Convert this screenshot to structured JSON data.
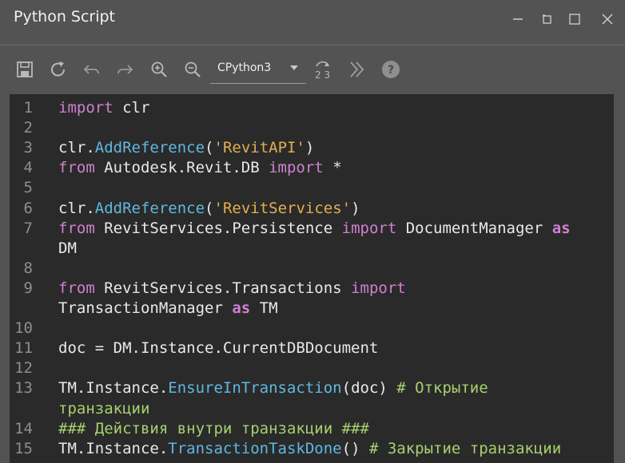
{
  "window": {
    "title": "Python Script"
  },
  "toolbar": {
    "icons": [
      "save-icon",
      "refresh-icon",
      "undo-icon",
      "redo-icon",
      "zoom-in-icon",
      "zoom-out-icon",
      "run-icon",
      "more-icon",
      "help-icon"
    ],
    "engine_value": "CPython3",
    "run_label": "2 3",
    "help_label": "?"
  },
  "editor": {
    "lines": [
      {
        "num": "1",
        "tokens": [
          {
            "t": "import",
            "c": "kw"
          },
          {
            "t": " clr",
            "c": "ident"
          }
        ]
      },
      {
        "num": "2",
        "tokens": []
      },
      {
        "num": "3",
        "tokens": [
          {
            "t": "clr.",
            "c": "ident"
          },
          {
            "t": "AddReference",
            "c": "fn"
          },
          {
            "t": "(",
            "c": "ident"
          },
          {
            "t": "'RevitAPI'",
            "c": "str"
          },
          {
            "t": ")",
            "c": "ident"
          }
        ]
      },
      {
        "num": "4",
        "tokens": [
          {
            "t": "from",
            "c": "kw"
          },
          {
            "t": " Autodesk.Revit.DB ",
            "c": "ident"
          },
          {
            "t": "import",
            "c": "kw"
          },
          {
            "t": " *",
            "c": "ident"
          }
        ]
      },
      {
        "num": "5",
        "tokens": []
      },
      {
        "num": "6",
        "tokens": [
          {
            "t": "clr.",
            "c": "ident"
          },
          {
            "t": "AddReference",
            "c": "fn"
          },
          {
            "t": "(",
            "c": "ident"
          },
          {
            "t": "'RevitServices'",
            "c": "str"
          },
          {
            "t": ")",
            "c": "ident"
          }
        ]
      },
      {
        "num": "7",
        "tokens": [
          {
            "t": "from",
            "c": "kw"
          },
          {
            "t": " RevitServices.Persistence ",
            "c": "ident"
          },
          {
            "t": "import",
            "c": "kw"
          },
          {
            "t": " DocumentManager ",
            "c": "ident"
          },
          {
            "t": "as",
            "c": "as"
          }
        ]
      },
      {
        "num": "",
        "tokens": [
          {
            "t": "DM",
            "c": "ident"
          }
        ]
      },
      {
        "num": "8",
        "tokens": []
      },
      {
        "num": "9",
        "tokens": [
          {
            "t": "from",
            "c": "kw"
          },
          {
            "t": " RevitServices.Transactions ",
            "c": "ident"
          },
          {
            "t": "import",
            "c": "kw"
          }
        ]
      },
      {
        "num": "",
        "tokens": [
          {
            "t": "TransactionManager ",
            "c": "ident"
          },
          {
            "t": "as",
            "c": "as"
          },
          {
            "t": " TM",
            "c": "ident"
          }
        ]
      },
      {
        "num": "10",
        "tokens": []
      },
      {
        "num": "11",
        "tokens": [
          {
            "t": "doc = DM.Instance.CurrentDBDocument",
            "c": "ident"
          }
        ]
      },
      {
        "num": "12",
        "tokens": []
      },
      {
        "num": "13",
        "tokens": [
          {
            "t": "TM.Instance.",
            "c": "ident"
          },
          {
            "t": "EnsureInTransaction",
            "c": "fn"
          },
          {
            "t": "(doc) ",
            "c": "ident"
          },
          {
            "t": "# Открытие",
            "c": "cm"
          }
        ]
      },
      {
        "num": "",
        "tokens": [
          {
            "t": "транзакции",
            "c": "cm"
          }
        ]
      },
      {
        "num": "14",
        "tokens": [
          {
            "t": "### Действия внутри транзакции ###",
            "c": "cm"
          }
        ]
      },
      {
        "num": "15",
        "tokens": [
          {
            "t": "TM.Instance.",
            "c": "ident"
          },
          {
            "t": "TransactionTaskDone",
            "c": "fn"
          },
          {
            "t": "() ",
            "c": "ident"
          },
          {
            "t": "# Закрытие транзакции",
            "c": "cm"
          }
        ]
      }
    ]
  }
}
